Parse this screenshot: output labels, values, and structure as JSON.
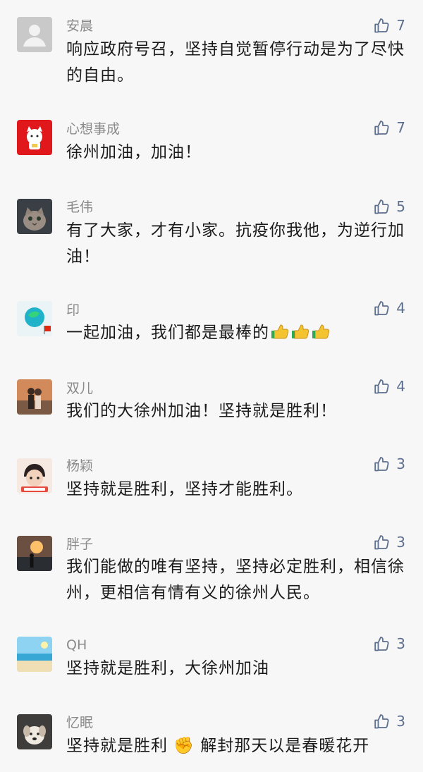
{
  "comments": [
    {
      "name": "安晨",
      "text": "响应政府号召，坚持自觉暂停行动是为了尽快的自由。",
      "likes": "7",
      "avatar": "blank-avatar"
    },
    {
      "name": "心想事成",
      "text": "徐州加油，加油！",
      "likes": "7",
      "avatar": "lucky-cat-avatar"
    },
    {
      "name": "毛伟",
      "text": "有了大家，才有小家。抗疫你我他，为逆行加油！",
      "likes": "5",
      "avatar": "cat-photo-avatar"
    },
    {
      "name": "印",
      "text": "一起加油，我们都是最棒的",
      "likes": "4",
      "avatar": "globe-flag-avatar"
    },
    {
      "name": "双儿",
      "text": "我们的大徐州加油！坚持就是胜利！",
      "likes": "4",
      "avatar": "couple-photo-avatar"
    },
    {
      "name": "杨颖",
      "text": "坚持就是胜利，坚持才能胜利。",
      "likes": "3",
      "avatar": "cartoon-avatar"
    },
    {
      "name": "胖子",
      "text": "我们能做的唯有坚持，坚持必定胜利，相信徐州，更相信有情有义的徐州人民。",
      "likes": "3",
      "avatar": "sunset-silhouette-avatar"
    },
    {
      "name": "QH",
      "text": "坚持就是胜利，大徐州加油",
      "likes": "3",
      "avatar": "beach-avatar"
    },
    {
      "name": "忆眠",
      "text": "坚持就是胜利 ✊ 解封那天以是春暖花开",
      "likes": "3",
      "avatar": "dog-photo-avatar"
    }
  ],
  "colors": {
    "background": "#f7f7f7",
    "name_text": "#8a8a8a",
    "body_text": "#1b1b1b",
    "like_color": "#5d6f8f"
  },
  "icons": {
    "like": "thumbs-up-outline-icon",
    "emoji_thumbs": "thumbs-up-emoji",
    "emoji_fist": "raised-fist-emoji"
  }
}
